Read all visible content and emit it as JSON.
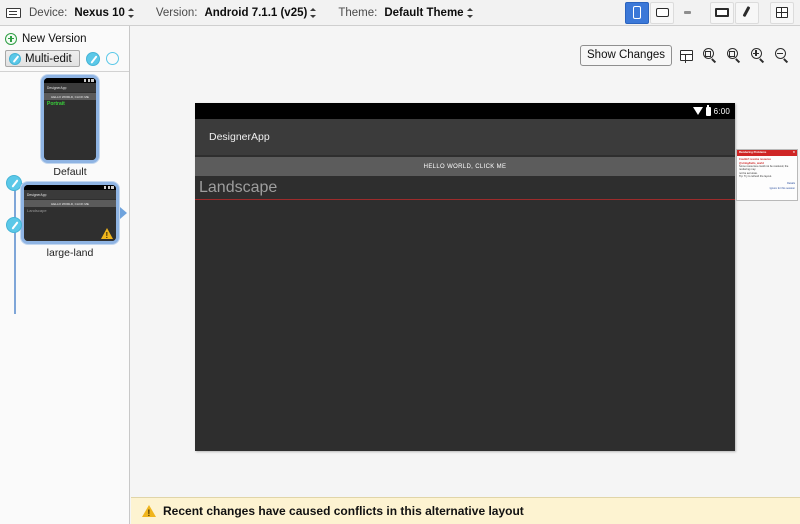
{
  "toolbar": {
    "keyboard_icon": "keyboard-icon",
    "device_label": "Device:",
    "device_value": "Nexus 10",
    "version_label": "Version:",
    "version_value": "Android 7.1.1 (v25)",
    "theme_label": "Theme:",
    "theme_value": "Default Theme",
    "view_modes": [
      {
        "name": "phone-view-toggle",
        "icon": "phone-icon",
        "active": true
      },
      {
        "name": "tablet-view-toggle",
        "icon": "tablet-landscape-icon",
        "active": false
      },
      {
        "name": "compact-view-toggle",
        "icon": "dash-icon",
        "active": false
      },
      {
        "name": "widescreen-view-toggle",
        "icon": "widescreen-icon",
        "active": false
      },
      {
        "name": "theme-brush-toggle",
        "icon": "paintbrush-icon",
        "active": false
      },
      {
        "name": "layout-grid-toggle",
        "icon": "layout-grid-icon",
        "active": false
      }
    ]
  },
  "sidebar": {
    "new_version_label": "New Version",
    "new_version_icon": "plus-circle-icon",
    "multi_edit_label": "Multi-edit",
    "multi_edit_icon": "pencil-icon",
    "edit_pencil_icon": "pencil-icon",
    "empty_circle_icon": "circle-outline-icon",
    "variations": [
      {
        "label": "Default",
        "orientation": "portrait",
        "app_name": "DesignerApp",
        "button_text": "HELLO WORLD, CLICK ME",
        "body_text": "Portrait",
        "has_warning": false
      },
      {
        "label": "large-land",
        "orientation": "landscape",
        "app_name": "DesignerApp",
        "button_text": "HELLO WORLD, CLICK ME",
        "body_text": "Landscape",
        "has_warning": true,
        "warning_icon": "warning-triangle-icon"
      }
    ]
  },
  "canvas": {
    "show_changes_label": "Show Changes",
    "tools": [
      {
        "name": "split-layout-button",
        "icon": "split-layout-icon"
      },
      {
        "name": "zoom-fit-button",
        "icon": "zoom-fit-icon"
      },
      {
        "name": "zoom-actual-button",
        "icon": "zoom-actual-icon"
      },
      {
        "name": "zoom-in-button",
        "icon": "zoom-in-icon"
      },
      {
        "name": "zoom-out-button",
        "icon": "zoom-out-icon"
      }
    ],
    "device_preview": {
      "status_time": "6:00",
      "wifi_icon": "wifi-icon",
      "battery_icon": "battery-icon",
      "app_name": "DesignerApp",
      "button_text": "HELLO WORLD, CLICK ME",
      "body_text": "Landscape"
    },
    "error_popup": {
      "title": "Rendering Problems",
      "close_icon": "close-icon",
      "body_line1": "Couldn't resolve resource @string/hello_world",
      "body_line2": "Some resources could not be resolved, the rendering may",
      "body_line3": "not be accurate.",
      "body_line4": "Tip: Try to refresh the layout.",
      "link1": "Details",
      "link2": "Ignore for this session"
    }
  },
  "statusbar": {
    "warning_icon": "warning-triangle-icon",
    "message": "Recent changes have caused conflicts in this alternative layout"
  },
  "colors": {
    "accent_blue": "#3b78d8",
    "node_border": "#8fb4e3",
    "badge_cyan": "#5bc8e8",
    "warning_yellow": "#f0b51c",
    "error_red": "#cf2525",
    "status_bg": "#fdf3d1",
    "preview_bg": "#2e2e2e",
    "text_green": "#39d13a"
  }
}
